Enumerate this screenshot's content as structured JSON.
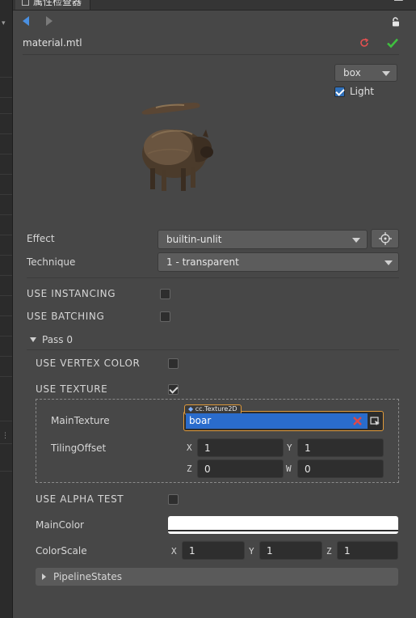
{
  "tab": {
    "title": "属性检查器"
  },
  "asset": {
    "name": "material.mtl"
  },
  "preview": {
    "shape": "box",
    "light_label": "Light",
    "light_checked": true
  },
  "props": {
    "effect_label": "Effect",
    "effect_value": "builtin-unlit",
    "technique_label": "Technique",
    "technique_value": "1 - transparent",
    "use_instancing_label": "USE INSTANCING",
    "use_instancing": false,
    "use_batching_label": "USE BATCHING",
    "use_batching": false
  },
  "pass": {
    "label": "Pass 0",
    "use_vertex_color_label": "USE VERTEX COLOR",
    "use_vertex_color": false,
    "use_texture_label": "USE TEXTURE",
    "use_texture": true,
    "main_texture_label": "MainTexture",
    "main_texture_type": "cc.Texture2D",
    "main_texture_value": "boar",
    "tiling_offset_label": "TilingOffset",
    "tiling": {
      "x_label": "X",
      "x": "1",
      "y_label": "Y",
      "y": "1",
      "z_label": "Z",
      "z": "0",
      "w_label": "W",
      "w": "0"
    },
    "use_alpha_test_label": "USE ALPHA TEST",
    "use_alpha_test": false,
    "main_color_label": "MainColor",
    "main_color": "#ffffff",
    "color_scale_label": "ColorScale",
    "color_scale": {
      "x_label": "X",
      "x": "1",
      "y_label": "Y",
      "y": "1",
      "z_label": "Z",
      "z": "1"
    },
    "pipeline_states_label": "PipelineStates"
  },
  "colors": {
    "accent_blue": "#2a6ccc",
    "revert_red": "#e05050",
    "apply_green": "#3fbf3f",
    "texture_border": "#e09a3a"
  },
  "icons": [
    "back-arrow-icon",
    "forward-arrow-icon",
    "lock-icon",
    "revert-icon",
    "apply-check-icon",
    "dropdown-arrow-icon",
    "crosshair-icon",
    "clear-icon",
    "asset-picker-icon",
    "expand-arrow-icon"
  ]
}
